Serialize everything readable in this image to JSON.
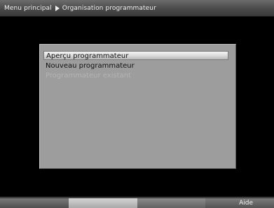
{
  "header": {
    "crumb_root": "Menu principal",
    "crumb_current": "Organisation programmateur",
    "arrow_icon": "arrow-right-icon"
  },
  "menu": {
    "items": [
      {
        "label": "Aperçu programmateur",
        "state": "selected"
      },
      {
        "label": "Nouveau programmateur",
        "state": "normal"
      },
      {
        "label": "Programmateur existant",
        "state": "disabled"
      }
    ]
  },
  "footer": {
    "keys": [
      {
        "label": "",
        "color": "#7a7a7a"
      },
      {
        "label": "",
        "color": "#d4d4d4"
      },
      {
        "label": "",
        "color": "#8c8c8c"
      },
      {
        "label": "Aide",
        "color": "#7c7c7c"
      }
    ]
  }
}
